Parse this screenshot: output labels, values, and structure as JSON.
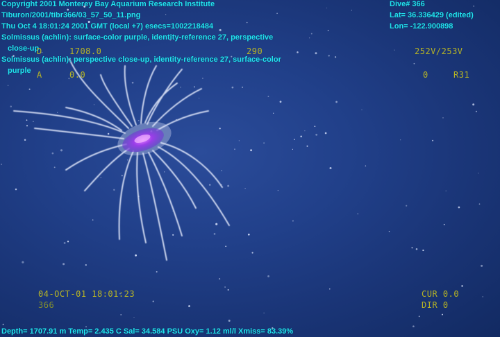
{
  "caption": {
    "copyright": "Copyright 2001 Monterey Bay Aquarium Research Institute",
    "filepath": "Tiburon/2001/tibr366/03_57_50_11.png",
    "datetime": "Thu Oct  4 18:01:24 2001 GMT (local +7)  esecs=1002218484",
    "annotation1_line1": "Solmissus (achlin): surface-color purple, identity-reference 27, perspective",
    "annotation1_line2": "close-up",
    "annotation2_line1": "Solmissus (achlin): perspective close-up, identity-reference 27, surface-color",
    "annotation2_line2": "purple",
    "dive": "Dive# 366",
    "lat": "Lat= 36.336429 (edited)",
    "lon": "Lon= -122.900898",
    "bottom_line": "Depth= 1707.91 m  Temp= 2.435 C  Sal= 34.584 PSU  Oxy= 1.12 ml/l  Xmiss= 83.39%"
  },
  "hud": {
    "depth_label": "D",
    "depth_value": "1708.0",
    "heading": "290",
    "voltage": "252V/253V",
    "alt_label": "A",
    "alt_value": "0.0",
    "zero": "0",
    "code": "R31",
    "date_time": "04-OCT-01 18:01:23",
    "dive_no": "366",
    "cur": "CUR 0.0",
    "dir": "DIR 0"
  }
}
